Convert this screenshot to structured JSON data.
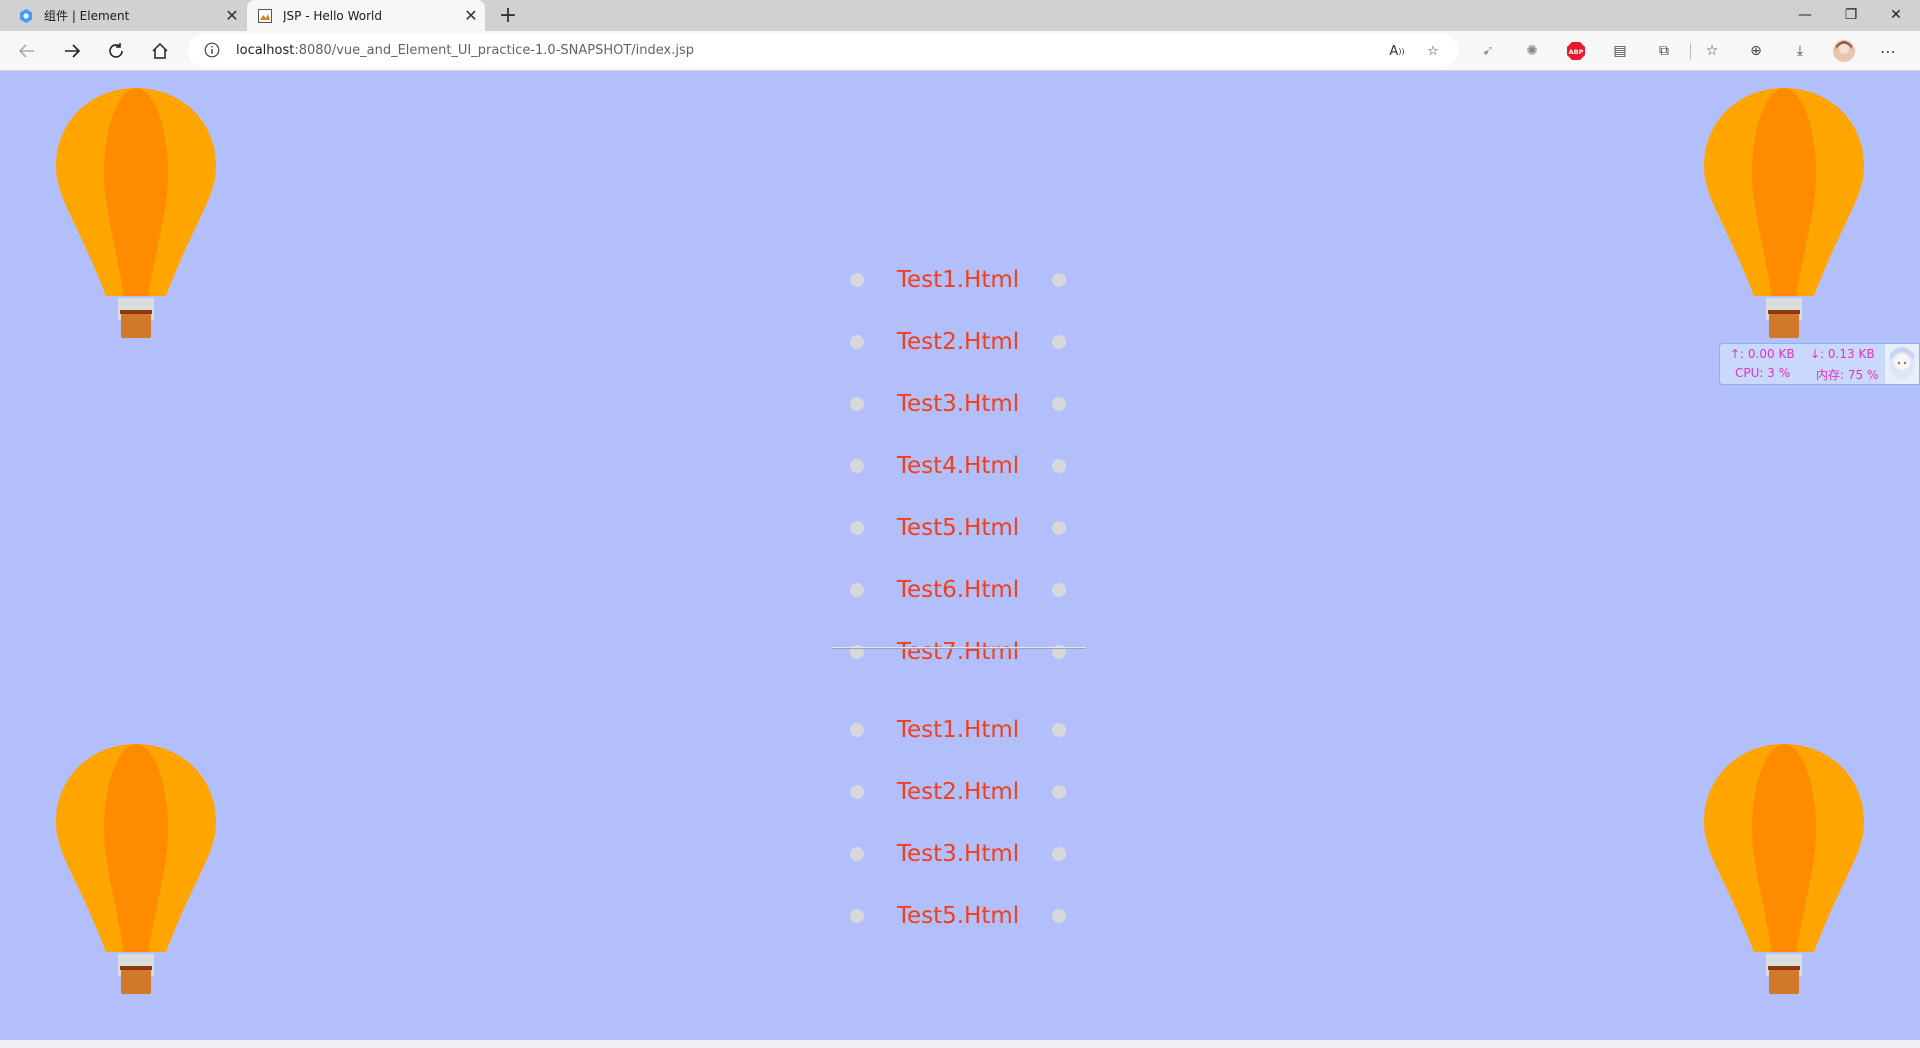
{
  "tabs": [
    {
      "title": "组件 | Element",
      "icon": "element-logo-icon"
    },
    {
      "title": "JSP - Hello World",
      "icon": "jsp-page-icon"
    }
  ],
  "address_bar": {
    "host": "localhost",
    "path": ":8080/vue_and_Element_UI_practice-1.0-SNAPSHOT/index.jsp"
  },
  "links_group_1": [
    "Test1.Html",
    "Test2.Html",
    "Test3.Html",
    "Test4.Html",
    "Test5.Html",
    "Test6.Html",
    "Test7.Html"
  ],
  "links_group_2": [
    "Test1.Html",
    "Test2.Html",
    "Test3.Html",
    "Test5.Html"
  ],
  "monitor": {
    "upload": "↑: 0.00 KB",
    "download": "↓: 0.13 KB",
    "cpu": "CPU: 3 %",
    "memory": "内存: 75 %"
  },
  "colors": {
    "page_background": "#b2bffa",
    "link": "#f0401b",
    "balloon": "#ffa500",
    "balloon_stripe": "#ff8c00",
    "basket": "#d2782a"
  }
}
